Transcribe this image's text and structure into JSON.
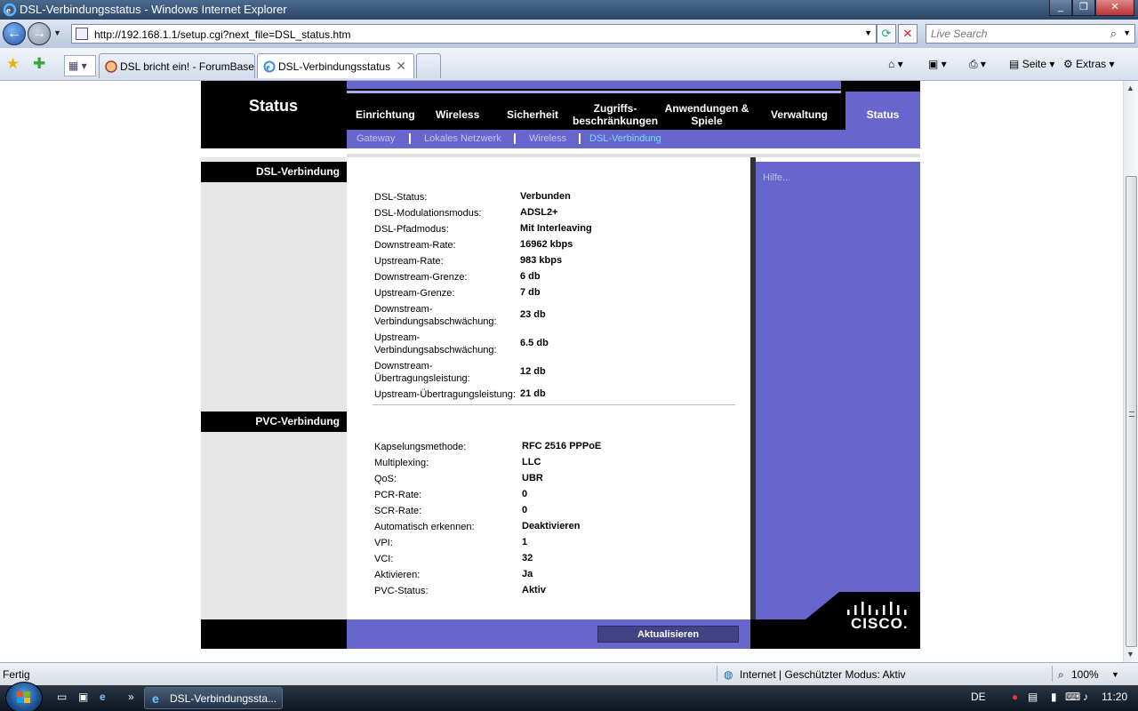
{
  "window": {
    "title": "DSL-Verbindungsstatus - Windows Internet Explorer",
    "buttons": [
      "_",
      "❐",
      "✕"
    ]
  },
  "address": {
    "url": "http://192.168.1.1/setup.cgi?next_file=DSL_status.htm",
    "search_placeholder": "Live Search"
  },
  "tabs": [
    {
      "label": "DSL bricht ein! - ForumBase",
      "active": false
    },
    {
      "label": "DSL-Verbindungsstatus",
      "active": true
    }
  ],
  "commands": {
    "page": "Seite",
    "tools": "Extras"
  },
  "router": {
    "section_heading": "Status",
    "nav": {
      "setup": "Einrichtung",
      "wireless": "Wireless",
      "security": "Sicherheit",
      "access_line1": "Zugriffs-",
      "access_line2": "beschränkungen",
      "apps_line1": "Anwendungen &",
      "apps_line2": "Spiele",
      "admin": "Verwaltung",
      "status": "Status"
    },
    "subnav": {
      "gateway": "Gateway",
      "lan": "Lokales Netzwerk",
      "wireless": "Wireless",
      "dsl": "DSL-Verbindung"
    },
    "dsl_section": "DSL-Verbindung",
    "pvc_section": "PVC-Verbindung",
    "help": "Hilfe...",
    "dsl_rows": [
      {
        "label": "DSL-Status:",
        "value": "Verbunden"
      },
      {
        "label": "DSL-Modulationsmodus:",
        "value": "ADSL2+"
      },
      {
        "label": "DSL-Pfadmodus:",
        "value": "Mit Interleaving"
      },
      {
        "label": "Downstream-Rate:",
        "value": "16962 kbps"
      },
      {
        "label": "Upstream-Rate:",
        "value": "983 kbps"
      },
      {
        "label": "Downstream-Grenze:",
        "value": "6 db"
      },
      {
        "label": "Upstream-Grenze:",
        "value": "7 db"
      },
      {
        "label": "Downstream-",
        "label2": "Verbindungsabschwächung:",
        "value": "23 db"
      },
      {
        "label": "Upstream-",
        "label2": "Verbindungsabschwächung:",
        "value": "6.5 db"
      },
      {
        "label": "Downstream-",
        "label2": "Übertragungsleistung:",
        "value": "12 db"
      },
      {
        "label": "Upstream-Übertragungsleistung:",
        "value": "21 db"
      }
    ],
    "pvc_rows": [
      {
        "label": "Kapselungsmethode:",
        "value": "RFC 2516 PPPoE"
      },
      {
        "label": "Multiplexing:",
        "value": "LLC"
      },
      {
        "label": "QoS:",
        "value": "UBR"
      },
      {
        "label": "PCR-Rate:",
        "value": "0"
      },
      {
        "label": "SCR-Rate:",
        "value": "0"
      },
      {
        "label": "Automatisch erkennen:",
        "value": "Deaktivieren"
      },
      {
        "label": "VPI:",
        "value": "1"
      },
      {
        "label": "VCI:",
        "value": "32"
      },
      {
        "label": "Aktivieren:",
        "value": "Ja"
      },
      {
        "label": "PVC-Status:",
        "value": "Aktiv"
      }
    ],
    "refresh_button": "Aktualisieren",
    "brand": "CISCO."
  },
  "statusbar": {
    "left": "Fertig",
    "zone": "Internet | Geschützter Modus: Aktiv",
    "zoom": "100%"
  },
  "taskbar": {
    "window_button": "DSL-Verbindungssta...",
    "language": "DE",
    "clock": "11:20"
  },
  "colors": {
    "router_purple": "#6666cc",
    "router_black": "#000000",
    "button_navy": "#424287",
    "active_sublink": "#7fd9ff"
  }
}
